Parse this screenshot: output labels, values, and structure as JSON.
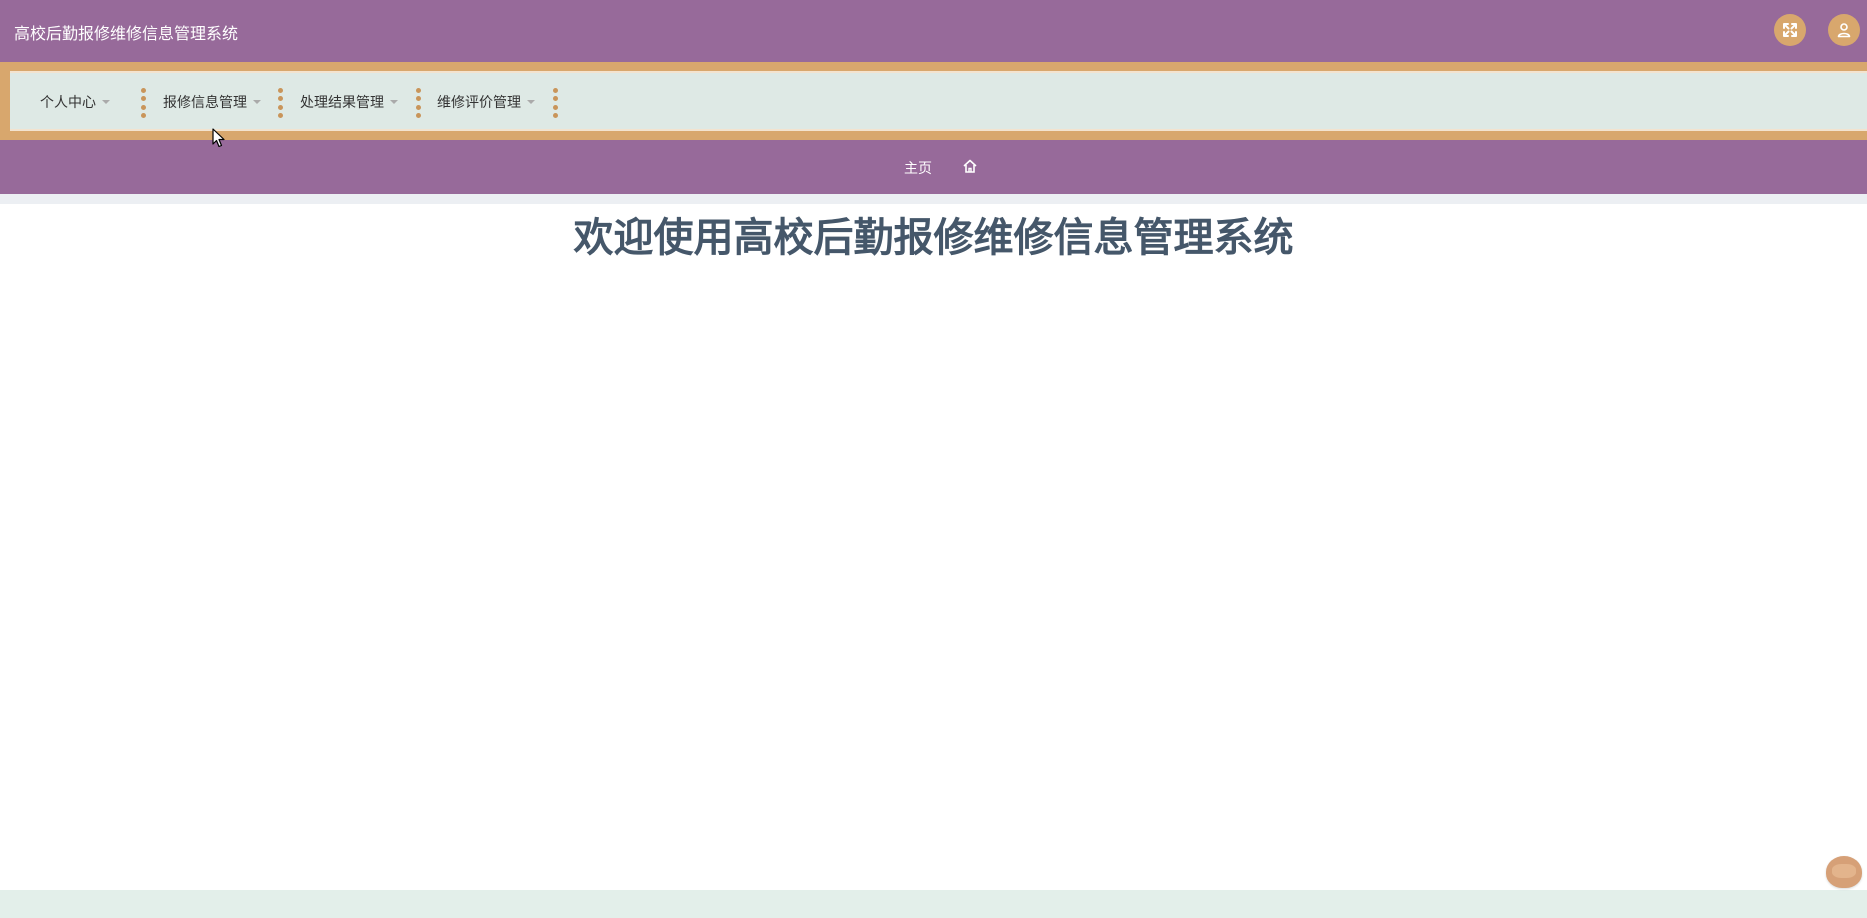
{
  "header": {
    "app_title": "高校后勤报修维修信息管理系统",
    "fullscreen_icon": "fullscreen-icon",
    "user_icon": "user-icon"
  },
  "menu": {
    "items": [
      {
        "label": "个人中心"
      },
      {
        "label": "报修信息管理"
      },
      {
        "label": "处理结果管理"
      },
      {
        "label": "维修评价管理"
      }
    ]
  },
  "breadcrumb": {
    "home_label": "主页",
    "home_icon": "home-icon"
  },
  "main": {
    "welcome_text": "欢迎使用高校后勤报修维修信息管理系统"
  },
  "colors": {
    "header_bg": "#976a9a",
    "menu_accent": "#d8a76d",
    "menu_bg": "#dee9e5",
    "title_text": "#45576a"
  }
}
